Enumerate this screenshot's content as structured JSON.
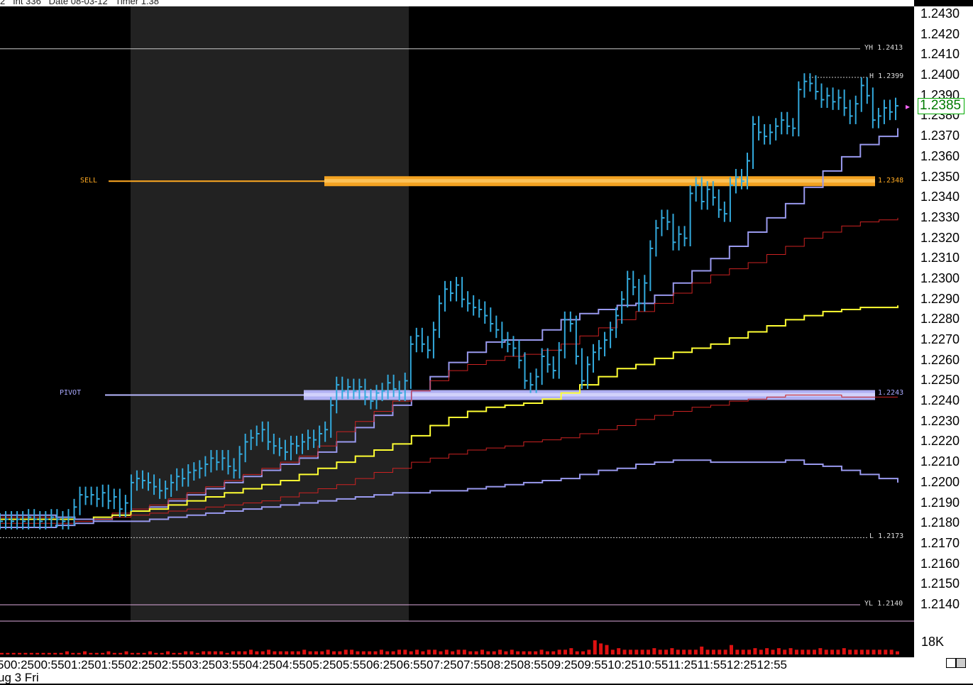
{
  "header": {
    "text": "2   Int 336   Date 08-03-12   Timer 1.38"
  },
  "colors": {
    "background": "#000000",
    "price_bars": "#33aadd",
    "vwap_band_outer": "#9999ee",
    "vwap_band_inner": "#cc2222",
    "vwap_center": "#ffff33",
    "sell_zone": "#ffaa22",
    "pivot_zone": "#b8b8ff",
    "session_shade": "#222222"
  },
  "levels": {
    "yh": {
      "label": "YH",
      "value": "1.2413"
    },
    "h": {
      "label": "H",
      "value": "1.2399"
    },
    "sell": {
      "label": "SELL",
      "value": "1.2348"
    },
    "pivot": {
      "label": "PIVOT",
      "value": "1.2243"
    },
    "l": {
      "label": "L",
      "value": "1.2173"
    },
    "yl": {
      "label": "YL",
      "value": "1.2140"
    }
  },
  "current_price": "1.2385",
  "volume_label": "18K",
  "time_axis": {
    "tick_text": "500:2500:5501:2501:5502:2502:5503:2503:5504:2504:5505:2505:5506:2506:5507:2507:5508:2508:5509:2509:5510:2510:5511:2511:5512:2512:55",
    "date_text": "ug 3 Fri"
  },
  "chart_data": {
    "type": "line",
    "title": "",
    "ylim": [
      1.2132,
      1.2435
    ],
    "yticks": [
      "1.2430",
      "1.2420",
      "1.2410",
      "1.2400",
      "1.2390",
      "1.2380",
      "1.2370",
      "1.2360",
      "1.2350",
      "1.2340",
      "1.2330",
      "1.2320",
      "1.2310",
      "1.2300",
      "1.2290",
      "1.2280",
      "1.2270",
      "1.2260",
      "1.2250",
      "1.2240",
      "1.2230",
      "1.2220",
      "1.2210",
      "1.2200",
      "1.2190",
      "1.2180",
      "1.2170",
      "1.2160",
      "1.2150",
      "1.2140"
    ],
    "xticks": [
      "00:25",
      "00:55",
      "01:25",
      "01:55",
      "02:25",
      "02:55",
      "03:25",
      "03:55",
      "04:25",
      "04:55",
      "05:25",
      "05:55",
      "06:25",
      "06:55",
      "07:25",
      "07:55",
      "08:25",
      "08:55",
      "09:25",
      "09:55",
      "10:25",
      "10:55",
      "11:25",
      "11:55",
      "12:25",
      "12:55"
    ],
    "price_close": [
      1.2181,
      1.2182,
      1.2181,
      1.2182,
      1.2181,
      1.2183,
      1.2182,
      1.2181,
      1.2182,
      1.2183,
      1.2182,
      1.2181,
      1.2183,
      1.2188,
      1.2194,
      1.2193,
      1.2194,
      1.2192,
      1.2195,
      1.2191,
      1.2193,
      1.2187,
      1.219,
      1.22,
      1.2202,
      1.2201,
      1.22,
      1.2198,
      1.2196,
      1.2197,
      1.22,
      1.2203,
      1.2202,
      1.2205,
      1.2206,
      1.2207,
      1.2209,
      1.2212,
      1.221,
      1.2212,
      1.2208,
      1.2206,
      1.2214,
      1.222,
      1.2222,
      1.2224,
      1.2226,
      1.222,
      1.2218,
      1.2217,
      1.2215,
      1.2219,
      1.2218,
      1.222,
      1.2222,
      1.2221,
      1.2224,
      1.2226,
      1.2238,
      1.2248,
      1.2245,
      1.2247,
      1.2245,
      1.2247,
      1.2242,
      1.224,
      1.2244,
      1.2245,
      1.2249,
      1.2246,
      1.2244,
      1.225,
      1.2268,
      1.2272,
      1.2268,
      1.2265,
      1.2275,
      1.2288,
      1.2295,
      1.2293,
      1.2297,
      1.229,
      1.2288,
      1.2286,
      1.2285,
      1.2282,
      1.2278,
      1.2275,
      1.227,
      1.2268,
      1.2266,
      1.226,
      1.225,
      1.2248,
      1.2252,
      1.2262,
      1.2258,
      1.2255,
      1.2265,
      1.228,
      1.2278,
      1.2262,
      1.225,
      1.2258,
      1.2264,
      1.2266,
      1.227,
      1.2275,
      1.2282,
      1.229,
      1.23,
      1.2296,
      1.2288,
      1.2298,
      1.2315,
      1.2325,
      1.233,
      1.2328,
      1.2318,
      1.2322,
      1.232,
      1.2342,
      1.2346,
      1.2338,
      1.2344,
      1.234,
      1.2334,
      1.2332,
      1.2346,
      1.235,
      1.2348,
      1.2358,
      1.2376,
      1.2372,
      1.237,
      1.2372,
      1.2375,
      1.2378,
      1.2375,
      1.2374,
      1.2393,
      1.2397,
      1.2396,
      1.2392,
      1.2388,
      1.239,
      1.2387,
      1.2389,
      1.2384,
      1.238,
      1.2386,
      1.2395,
      1.239,
      1.2378,
      1.238,
      1.2384,
      1.2382,
      1.2385
    ],
    "series": [
      {
        "values": [
          1.2178,
          1.2178,
          1.2178,
          1.2179,
          1.218,
          1.2182,
          1.2184,
          1.2186,
          1.2188,
          1.2191,
          1.2194,
          1.2197,
          1.22,
          1.2203,
          1.2206,
          1.2209,
          1.2212,
          1.2215,
          1.222,
          1.2227,
          1.2233,
          1.2238,
          1.2245,
          1.2252,
          1.2259,
          1.2264,
          1.2269,
          1.227,
          1.227,
          1.2275,
          1.228,
          1.2283,
          1.2285,
          1.2287,
          1.2288,
          1.2292,
          1.2298,
          1.2304,
          1.231,
          1.2316,
          1.2323,
          1.233,
          1.2337,
          1.2345,
          1.2353,
          1.236,
          1.2366,
          1.237,
          1.2374
        ]
      },
      {
        "values": [
          1.218,
          1.218,
          1.218,
          1.218,
          1.2181,
          1.2183,
          1.2185,
          1.2187,
          1.2189,
          1.2192,
          1.2195,
          1.2198,
          1.2201,
          1.2204,
          1.2207,
          1.221,
          1.2213,
          1.2218,
          1.2225,
          1.223,
          1.2235,
          1.224,
          1.2245,
          1.225,
          1.2255,
          1.2258,
          1.226,
          1.2262,
          1.2263,
          1.2265,
          1.2268,
          1.2272,
          1.2276,
          1.228,
          1.2284,
          1.2288,
          1.2293,
          1.2298,
          1.2302,
          1.2305,
          1.2308,
          1.2312,
          1.2316,
          1.232,
          1.2323,
          1.2326,
          1.2328,
          1.2329,
          1.233
        ]
      },
      {
        "values": [
          1.2182,
          1.2182,
          1.2182,
          1.2182,
          1.2182,
          1.2183,
          1.2184,
          1.2186,
          1.2187,
          1.2189,
          1.2191,
          1.2193,
          1.2195,
          1.2197,
          1.2199,
          1.2201,
          1.2204,
          1.2207,
          1.221,
          1.2213,
          1.2216,
          1.2219,
          1.2223,
          1.2228,
          1.2232,
          1.2235,
          1.2237,
          1.2238,
          1.2239,
          1.2241,
          1.2244,
          1.2248,
          1.2252,
          1.2256,
          1.2258,
          1.2261,
          1.2264,
          1.2266,
          1.2268,
          1.2271,
          1.2274,
          1.2277,
          1.228,
          1.2282,
          1.2284,
          1.2285,
          1.2286,
          1.2286,
          1.2287
        ]
      },
      {
        "values": [
          1.2183,
          1.2183,
          1.2183,
          1.2183,
          1.2182,
          1.2182,
          1.2183,
          1.2184,
          1.2185,
          1.2186,
          1.2187,
          1.2188,
          1.2189,
          1.219,
          1.2191,
          1.2193,
          1.2195,
          1.2197,
          1.2199,
          1.2202,
          1.2205,
          1.2207,
          1.221,
          1.2212,
          1.2214,
          1.2216,
          1.2217,
          1.2218,
          1.222,
          1.2221,
          1.2222,
          1.2224,
          1.2226,
          1.2228,
          1.2231,
          1.2233,
          1.2235,
          1.2237,
          1.2238,
          1.224,
          1.2241,
          1.2242,
          1.2243,
          1.2243,
          1.2243,
          1.2242,
          1.2242,
          1.2242,
          1.2242
        ]
      },
      {
        "values": [
          1.2184,
          1.2184,
          1.2184,
          1.2183,
          1.2182,
          1.2181,
          1.2181,
          1.2181,
          1.2182,
          1.2183,
          1.2184,
          1.2185,
          1.2186,
          1.2187,
          1.2188,
          1.2189,
          1.219,
          1.2191,
          1.2192,
          1.2193,
          1.2194,
          1.2195,
          1.2195,
          1.2196,
          1.2196,
          1.2197,
          1.2198,
          1.2199,
          1.22,
          1.2201,
          1.2202,
          1.2204,
          1.2206,
          1.2207,
          1.2209,
          1.221,
          1.2211,
          1.2211,
          1.221,
          1.221,
          1.221,
          1.221,
          1.2211,
          1.2209,
          1.2208,
          1.2206,
          1.2204,
          1.2202,
          1.22
        ]
      }
    ],
    "volume": [
      1,
      1,
      1,
      1,
      1,
      1,
      1,
      1,
      1,
      1,
      1,
      2,
      1,
      1,
      2,
      1,
      1,
      1,
      2,
      1,
      1,
      2,
      1,
      1,
      1,
      2,
      1,
      1,
      2,
      1,
      1,
      2,
      2,
      1,
      2,
      2,
      2,
      2,
      1,
      2,
      2,
      2,
      3,
      2,
      2,
      3,
      2,
      2,
      2,
      2,
      2,
      3,
      2,
      2,
      2,
      3,
      2,
      2,
      3,
      3,
      2,
      2,
      2,
      2,
      3,
      2,
      2,
      3,
      3,
      2,
      3,
      2,
      3,
      3,
      2,
      3,
      2,
      3,
      3,
      2,
      2,
      3,
      2,
      2,
      3,
      2,
      3,
      2,
      2,
      2,
      2,
      3,
      2,
      2,
      3,
      3,
      4,
      2,
      2,
      3,
      9,
      7,
      6,
      3,
      4,
      3,
      3,
      3,
      3,
      3,
      4,
      3,
      3,
      4,
      3,
      3,
      3,
      3,
      5,
      3,
      3,
      3,
      3,
      6,
      3,
      3,
      3,
      4,
      3,
      4,
      3,
      4,
      3,
      4,
      3,
      3,
      3,
      3,
      4,
      3,
      3,
      3,
      4,
      3,
      3,
      3,
      3,
      3,
      3,
      3,
      3,
      2
    ],
    "volume_max": 18
  }
}
